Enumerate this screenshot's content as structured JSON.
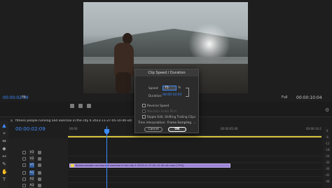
{
  "monitor": {
    "timecode": "00:00:02:09",
    "zoom": "Fit",
    "resolution": "Full",
    "duration": "00:00:10:04"
  },
  "timeline": {
    "sequence_name": "fitness people running and exercise in the city 4 2023-11-27-05-10-40-utc",
    "timecode": "00:00:02:09",
    "ruler_labels": [
      "00:00",
      "00:00:05:00",
      "00:00:14:2"
    ],
    "clip_label": "fitness people running and exercise in the city 4 2023-11-27-05-10-40-utc.mov [75%]",
    "tracks": [
      {
        "label": "V3",
        "targeted": false
      },
      {
        "label": "V2",
        "targeted": false
      },
      {
        "label": "V1",
        "targeted": true
      },
      {
        "label": "A1",
        "targeted": true
      },
      {
        "label": "A2",
        "targeted": false
      },
      {
        "label": "A3",
        "targeted": false
      }
    ],
    "tools": [
      "selection-icon",
      "track-select-icon",
      "ripple-edit-icon",
      "razor-icon",
      "slip-icon",
      "pen-icon",
      "hand-icon",
      "type-icon"
    ],
    "scroll_labels": [
      "0",
      "-6",
      "-12",
      "-18",
      "-24",
      "-30",
      "-36",
      "-42",
      "-48",
      "-54"
    ]
  },
  "dialog": {
    "title": "Clip Speed / Duration",
    "speed_label": "Speed:",
    "speed_value": "75",
    "speed_unit": "%",
    "duration_label": "Duration:",
    "duration_value": "00:00:10:03",
    "reverse_speed": "Reverse Speed",
    "maintain_audio": "Maintain Audio Pitch",
    "ripple_edit": "Ripple Edit, Shifting Trailing Clips",
    "interp_label": "Time Interpolation:",
    "interp_value": "Frame Sampling",
    "cancel": "Cancel",
    "ok": "OK",
    "checks": {
      "reverse": false,
      "maintain": false,
      "ripple": false
    }
  },
  "colors": {
    "accent": "#3d8cff",
    "clip": "#9b83d6",
    "workbar": "#d6c23a"
  }
}
